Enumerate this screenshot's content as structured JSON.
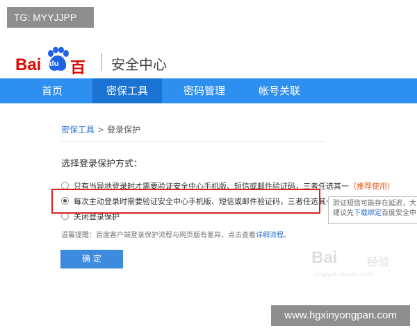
{
  "overlay": {
    "tg_label": "TG: MYYJJPP",
    "footer_watermark": "www.hgxinyongpan.com"
  },
  "header": {
    "logo_bai": "Bai",
    "logo_du": "du",
    "logo_cn": "百度",
    "subtitle": "安全中心"
  },
  "nav": {
    "items": [
      {
        "label": "首页"
      },
      {
        "label": "密保工具"
      },
      {
        "label": "密码管理"
      },
      {
        "label": "帐号关联"
      }
    ],
    "active_index": 1
  },
  "breadcrumb": {
    "parent": "密保工具",
    "separator": ">",
    "current": "登录保护"
  },
  "main": {
    "section_title": "选择登录保护方式：",
    "options": [
      {
        "label": "只有当异地登录时才需要验证安全中心手机版、短信或邮件验证码，三者任选其一",
        "tag": "（推荐使用）",
        "checked": false
      },
      {
        "label": "每次主动登录时需要验证安全中心手机版、短信或邮件验证码，三者任选其一",
        "tag": "",
        "checked": true
      },
      {
        "label": "关闭登录保护",
        "tag": "",
        "checked": false
      }
    ],
    "tip_line1": "验证短信可能存在延迟，大",
    "tip_line2_prefix": "建议先",
    "tip_link": "下载绑定",
    "tip_line2_suffix": "百度安全中",
    "notice_text": "温馨提醒：百度客户端登录保护流程与网页版有差异，点击查看",
    "notice_link": "详细流程",
    "notice_end": "。",
    "confirm_label": "确 定"
  },
  "watermark": {
    "main": "Bai",
    "du": "du",
    "sub": "经验",
    "url": "jingyan.baidu.com"
  },
  "colors": {
    "nav_bg": "#2d8ff0",
    "nav_active": "#1a72d2",
    "brand_red": "#e10601",
    "highlight": "#d9211e",
    "button": "#3d8bde"
  }
}
